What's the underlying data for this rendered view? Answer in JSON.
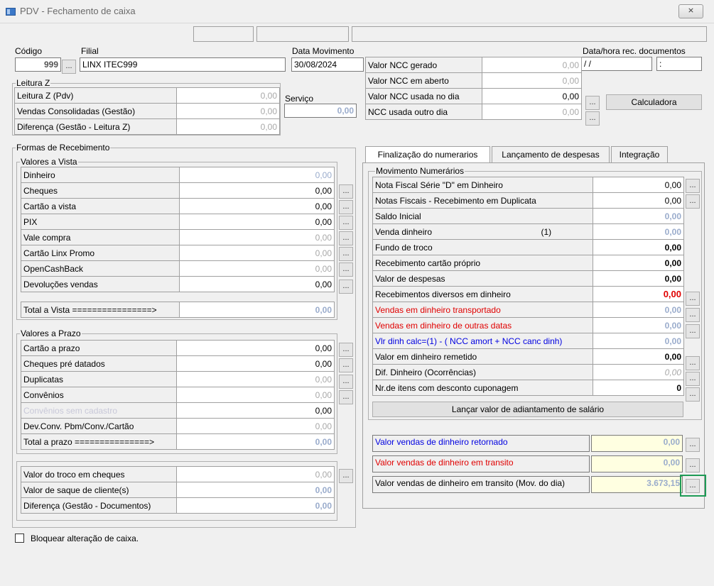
{
  "window": {
    "title": "PDV - Fechamento de caixa",
    "close_label": "⨯",
    "app_icon": "app-window-icon"
  },
  "header": {
    "codigo_label": "Código",
    "codigo_value": "999",
    "filial_label": "Filial",
    "filial_value": "LINX ITEC999",
    "data_mov_label": "Data Movimento",
    "data_mov_value": "30/08/2024",
    "data_hora_label": "Data/hora rec. documentos",
    "data_value": " / /",
    "hora_value": ":",
    "lookup_btn": "..."
  },
  "leitura_z": {
    "legend": "Leitura Z",
    "rows": [
      {
        "label": "Leitura Z (Pdv)",
        "value": "0,00"
      },
      {
        "label": "Vendas Consolidadas (Gestão)",
        "value": "0,00"
      },
      {
        "label": "Diferença (Gestão - Leitura Z)",
        "value": "0,00"
      }
    ],
    "servico_label": "Serviço",
    "servico_value": "0,00"
  },
  "ncc": {
    "rows": [
      {
        "label": "Valor NCC gerado",
        "value": "0,00"
      },
      {
        "label": "Valor NCC em aberto",
        "value": "0,00"
      },
      {
        "label": "Valor NCC usada no dia",
        "value": "0,00"
      },
      {
        "label": "NCC usada outro dia",
        "value": "0,00"
      }
    ],
    "calculadora_label": "Calculadora",
    "btn": "..."
  },
  "formas": {
    "legend": "Formas de Recebimento",
    "vista_legend": "Valores a Vista",
    "vista_rows": [
      {
        "label": "Dinheiro",
        "value": "0,00"
      },
      {
        "label": "Cheques",
        "value": "0,00"
      },
      {
        "label": "Cartão a vista",
        "value": "0,00"
      },
      {
        "label": "PIX",
        "value": "0,00"
      },
      {
        "label": "Vale compra",
        "value": "0,00"
      },
      {
        "label": "Cartão Linx Promo",
        "value": "0,00"
      },
      {
        "label": "OpenCashBack",
        "value": "0,00"
      },
      {
        "label": "Devoluções vendas",
        "value": "0,00"
      }
    ],
    "total_vista_label": "Total a Vista ================>",
    "total_vista_value": "0,00",
    "prazo_legend": "Valores a Prazo",
    "prazo_rows": [
      {
        "label": "Cartão a prazo",
        "value": "0,00"
      },
      {
        "label": "Cheques pré datados",
        "value": "0,00"
      },
      {
        "label": "Duplicatas",
        "value": "0,00"
      },
      {
        "label": "Convênios",
        "value": "0,00"
      },
      {
        "label": "Convênios sem cadastro",
        "value": "0,00"
      },
      {
        "label": "Dev.Conv. Pbm/Conv./Cartão",
        "value": "0,00"
      }
    ],
    "total_prazo_label": "Total a prazo ===============>",
    "total_prazo_value": "0,00",
    "docs_rows": [
      {
        "label": "Valor do troco em cheques",
        "value": "0,00"
      },
      {
        "label": "Valor de saque de cliente(s)",
        "value": "0,00"
      },
      {
        "label": "Diferença (Gestão - Documentos)",
        "value": "0,00"
      }
    ]
  },
  "tabs": [
    {
      "label": "Finalização do numerarios"
    },
    {
      "label": "Lançamento de despesas"
    },
    {
      "label": "Integração"
    }
  ],
  "numerarios": {
    "legend": "Movimento Numerários",
    "rows": [
      {
        "label": "Nota Fiscal Série \"D\" em Dinheiro",
        "value": "0,00"
      },
      {
        "label": "Notas Fiscais - Recebimento em Duplicata",
        "value": "0,00"
      },
      {
        "label": "Saldo Inicial",
        "value": "0,00"
      },
      {
        "label": "Venda dinheiro",
        "note": "(1)",
        "value": "0,00"
      },
      {
        "label": "Fundo de troco",
        "value": "0,00"
      },
      {
        "label": "Recebimento cartão próprio",
        "value": "0,00"
      },
      {
        "label": "Valor de despesas",
        "value": "0,00"
      },
      {
        "label": "Recebimentos diversos em dinheiro",
        "value": "0,00"
      },
      {
        "label": "Vendas em dinheiro transportado",
        "value": "0,00"
      },
      {
        "label": "Vendas em dinheiro de outras datas",
        "value": "0,00"
      },
      {
        "label": "Vlr dinh calc=(1) -   ( NCC amort +  NCC canc dinh)",
        "value": "0,00"
      },
      {
        "label": "Valor em dinheiro remetido",
        "value": "0,00"
      },
      {
        "label": "Dif. Dinheiro (Ocorrências)",
        "value": "0,00"
      },
      {
        "label": "Nr.de itens com desconto cuponagem",
        "value": "0"
      }
    ],
    "adiantamento_label": "Lançar valor de adiantamento de salário",
    "retorno_rows": [
      {
        "label": "Valor vendas de dinheiro retornado",
        "value": "0,00"
      },
      {
        "label": "Valor vendas de dinheiro em transito",
        "value": "0,00"
      },
      {
        "label": "Valor vendas de dinheiro em transito (Mov. do dia)",
        "value": "3.673,15"
      }
    ]
  },
  "bloquear_label": "Bloquear alteração de caixa.",
  "colors": {
    "accent_red": "#e00000",
    "accent_blue": "#0000e0",
    "focus_green": "#1e9b56",
    "readonly_yellow": "#ffffe1"
  }
}
